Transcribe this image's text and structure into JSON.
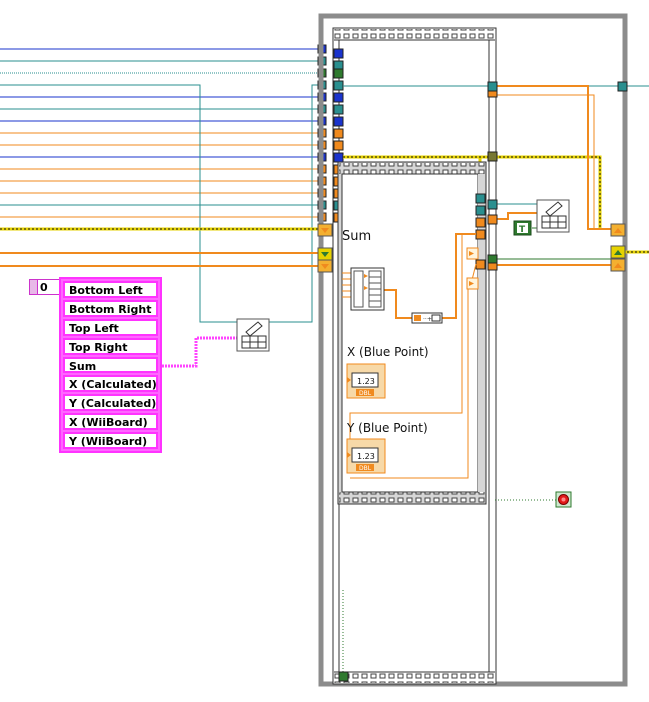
{
  "array_index": {
    "value": "0"
  },
  "string_array": {
    "items": [
      "Bottom Left",
      "Bottom Right",
      "Top Left",
      "Top Right",
      "Sum",
      "X (Calculated)",
      "Y (Calculated)",
      "X (WiiBoard)",
      "Y (WiiBoard)"
    ]
  },
  "labels": {
    "sum": "Sum",
    "x_blue_point": "X (Blue Point)",
    "y_blue_point": "Y (Blue Point)"
  },
  "indicators": {
    "numeric_display": "1.23",
    "numeric_type": "DBL"
  },
  "constants": {
    "boolean_true": "T"
  },
  "colors": {
    "frame_gray": "#8c8c8c",
    "wire_orange": "#f08a1e",
    "wire_blue": "#1a33cc",
    "wire_teal": "#2a8f8f",
    "wire_green": "#2f7a2f",
    "wire_yellow": "#e6d200",
    "wire_pink": "#ff44ff",
    "stop_red": "#e21a1a"
  }
}
